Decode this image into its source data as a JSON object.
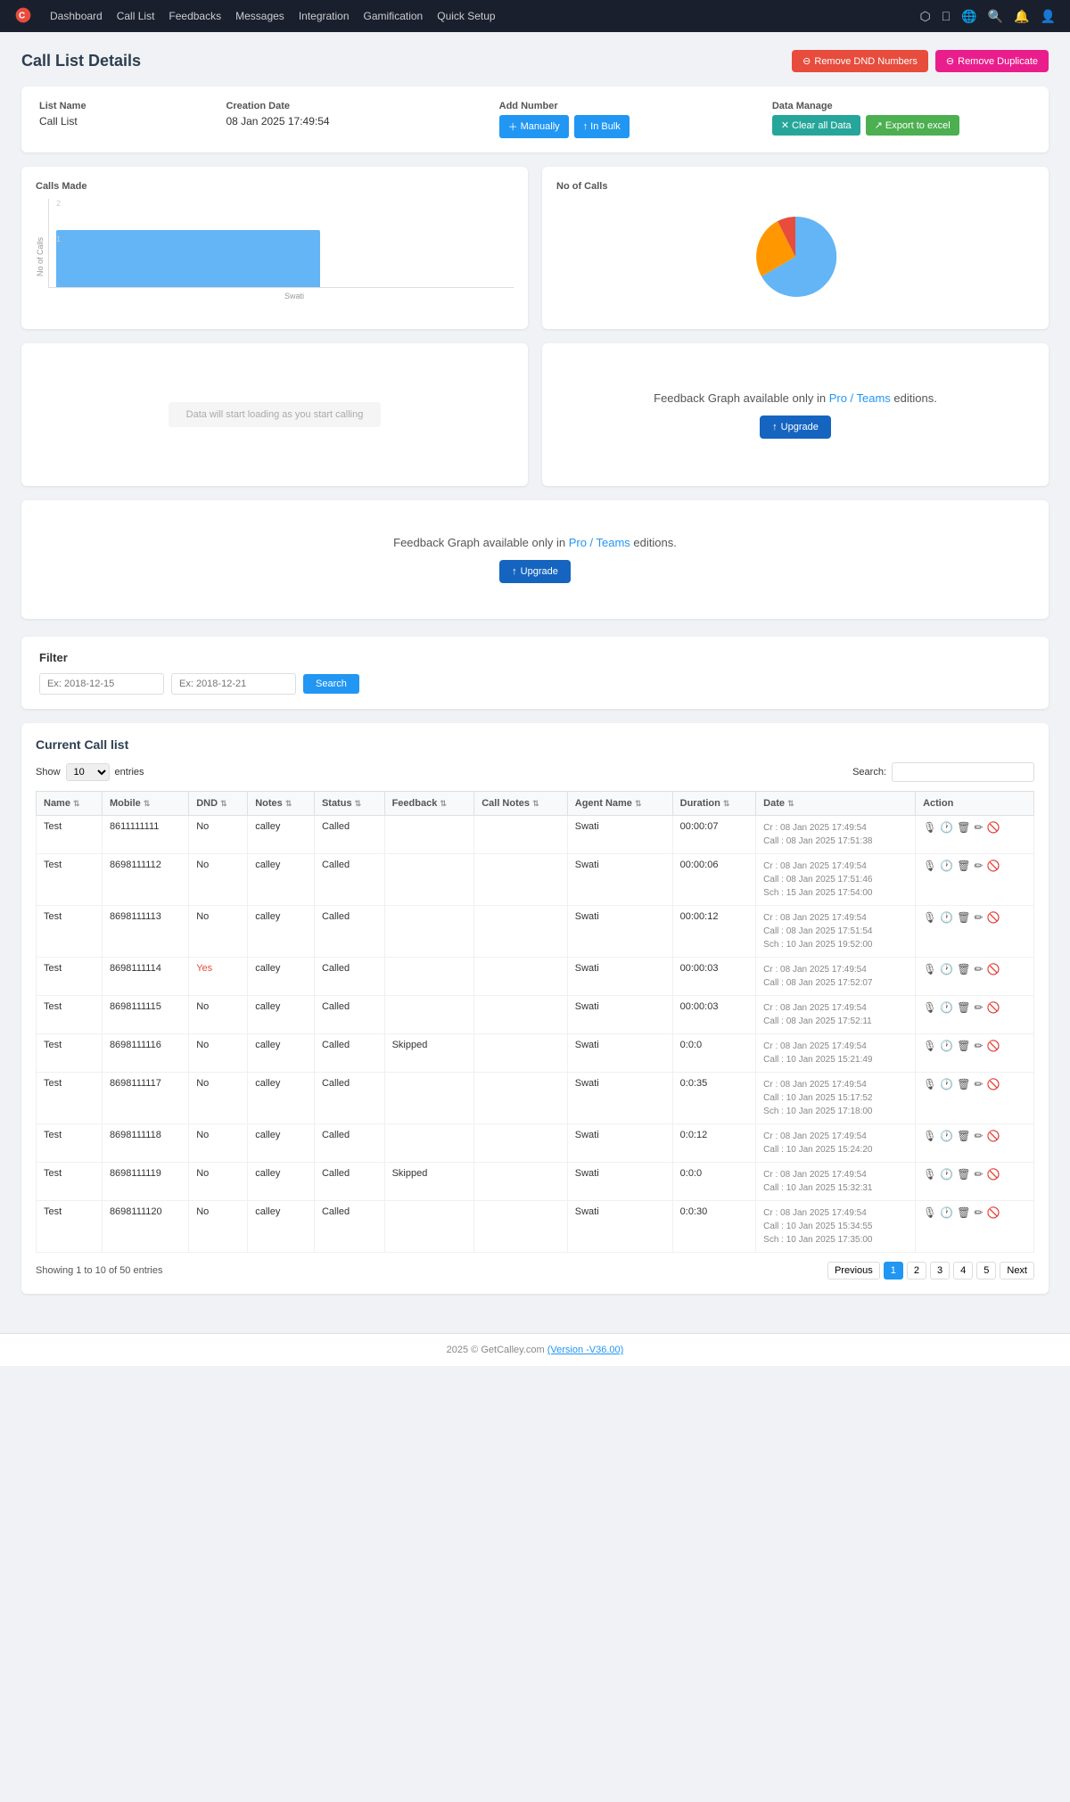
{
  "navbar": {
    "brand": "C",
    "links": [
      "Dashboard",
      "Call List",
      "Feedbacks",
      "Messages",
      "Integration",
      "Gamification",
      "Quick Setup"
    ]
  },
  "page": {
    "title": "Call List Details",
    "remove_dnd_label": "Remove DND Numbers",
    "remove_duplicate_label": "Remove Duplicate"
  },
  "info": {
    "list_name_label": "List Name",
    "list_name_value": "Call List",
    "creation_date_label": "Creation Date",
    "creation_date_value": "08 Jan 2025 17:49:54",
    "add_number_label": "Add Number",
    "manually_label": "Manually",
    "in_bulk_label": "In Bulk",
    "data_manage_label": "Data Manage",
    "clear_all_data_label": "Clear all Data",
    "export_to_excel_label": "Export to excel"
  },
  "charts": {
    "calls_made_title": "Calls Made",
    "no_of_calls_title": "No of Calls",
    "y_axis_label": "No of Calls",
    "x_label": "Swati",
    "data_loading_text": "Data will start loading as you start calling"
  },
  "feedback": {
    "text_before_link": "Feedback Graph available only in ",
    "link_text": "Pro / Teams",
    "text_after_link": " editions.",
    "upgrade_label": "Upgrade",
    "text_before_link2": "Feedback Graph available only in ",
    "link_text2": "Pro / Teams",
    "text_after_link2": " editions.",
    "upgrade_label2": "Upgrade"
  },
  "filter": {
    "title": "Filter",
    "placeholder1": "Ex: 2018-12-15",
    "placeholder2": "Ex: 2018-12-21",
    "search_label": "Search"
  },
  "table": {
    "title": "Current Call list",
    "show_label": "Show",
    "entries_label": "entries",
    "show_value": "10",
    "search_label": "Search:",
    "columns": [
      "Name",
      "Mobile",
      "DND",
      "Notes",
      "Status",
      "Feedback",
      "Call Notes",
      "Agent Name",
      "Duration",
      "Date",
      "Action"
    ],
    "rows": [
      {
        "name": "Test",
        "mobile": "8611111111",
        "dnd": "No",
        "notes": "calley",
        "status": "Called",
        "feedback": "",
        "call_notes": "",
        "agent": "Swati",
        "duration": "00:00:07",
        "date": "Cr : 08 Jan 2025 17:49:54\nCall : 08 Jan 2025 17:51:38"
      },
      {
        "name": "Test",
        "mobile": "8698111112",
        "dnd": "No",
        "notes": "calley",
        "status": "Called",
        "feedback": "",
        "call_notes": "",
        "agent": "Swati",
        "duration": "00:00:06",
        "date": "Cr : 08 Jan 2025 17:49:54\nCall : 08 Jan 2025 17:51:46\nSch : 15 Jan 2025 17:54:00"
      },
      {
        "name": "Test",
        "mobile": "8698111113",
        "dnd": "No",
        "notes": "calley",
        "status": "Called",
        "feedback": "",
        "call_notes": "",
        "agent": "Swati",
        "duration": "00:00:12",
        "date": "Cr : 08 Jan 2025 17:49:54\nCall : 08 Jan 2025 17:51:54\nSch : 10 Jan 2025 19:52:00"
      },
      {
        "name": "Test",
        "mobile": "8698111114",
        "dnd": "Yes",
        "notes": "calley",
        "status": "Called",
        "feedback": "",
        "call_notes": "",
        "agent": "Swati",
        "duration": "00:00:03",
        "date": "Cr : 08 Jan 2025 17:49:54\nCall : 08 Jan 2025 17:52:07"
      },
      {
        "name": "Test",
        "mobile": "8698111115",
        "dnd": "No",
        "notes": "calley",
        "status": "Called",
        "feedback": "",
        "call_notes": "",
        "agent": "Swati",
        "duration": "00:00:03",
        "date": "Cr : 08 Jan 2025 17:49:54\nCall : 08 Jan 2025 17:52:11"
      },
      {
        "name": "Test",
        "mobile": "8698111116",
        "dnd": "No",
        "notes": "calley",
        "status": "Called",
        "feedback": "Skipped",
        "call_notes": "",
        "agent": "Swati",
        "duration": "0:0:0",
        "date": "Cr : 08 Jan 2025 17:49:54\nCall : 10 Jan 2025 15:21:49"
      },
      {
        "name": "Test",
        "mobile": "8698111117",
        "dnd": "No",
        "notes": "calley",
        "status": "Called",
        "feedback": "",
        "call_notes": "",
        "agent": "Swati",
        "duration": "0:0:35",
        "date": "Cr : 08 Jan 2025 17:49:54\nCall : 10 Jan 2025 15:17:52\nSch : 10 Jan 2025 17:18:00"
      },
      {
        "name": "Test",
        "mobile": "8698111118",
        "dnd": "No",
        "notes": "calley",
        "status": "Called",
        "feedback": "",
        "call_notes": "",
        "agent": "Swati",
        "duration": "0:0:12",
        "date": "Cr : 08 Jan 2025 17:49:54\nCall : 10 Jan 2025 15:24:20"
      },
      {
        "name": "Test",
        "mobile": "8698111119",
        "dnd": "No",
        "notes": "calley",
        "status": "Called",
        "feedback": "Skipped",
        "call_notes": "",
        "agent": "Swati",
        "duration": "0:0:0",
        "date": "Cr : 08 Jan 2025 17:49:54\nCall : 10 Jan 2025 15:32:31"
      },
      {
        "name": "Test",
        "mobile": "8698111120",
        "dnd": "No",
        "notes": "calley",
        "status": "Called",
        "feedback": "",
        "call_notes": "",
        "agent": "Swati",
        "duration": "0:0:30",
        "date": "Cr : 08 Jan 2025 17:49:54\nCall : 10 Jan 2025 15:34:55\nSch : 10 Jan 2025 17:35:00"
      }
    ],
    "footer_text": "Showing 1 to 10 of 50 entries",
    "pagination": [
      "Previous",
      "1",
      "2",
      "3",
      "4",
      "5",
      "Next"
    ]
  },
  "footer": {
    "text": "2025 © GetCalley.com ",
    "version_label": "(Version -V36.00)"
  }
}
